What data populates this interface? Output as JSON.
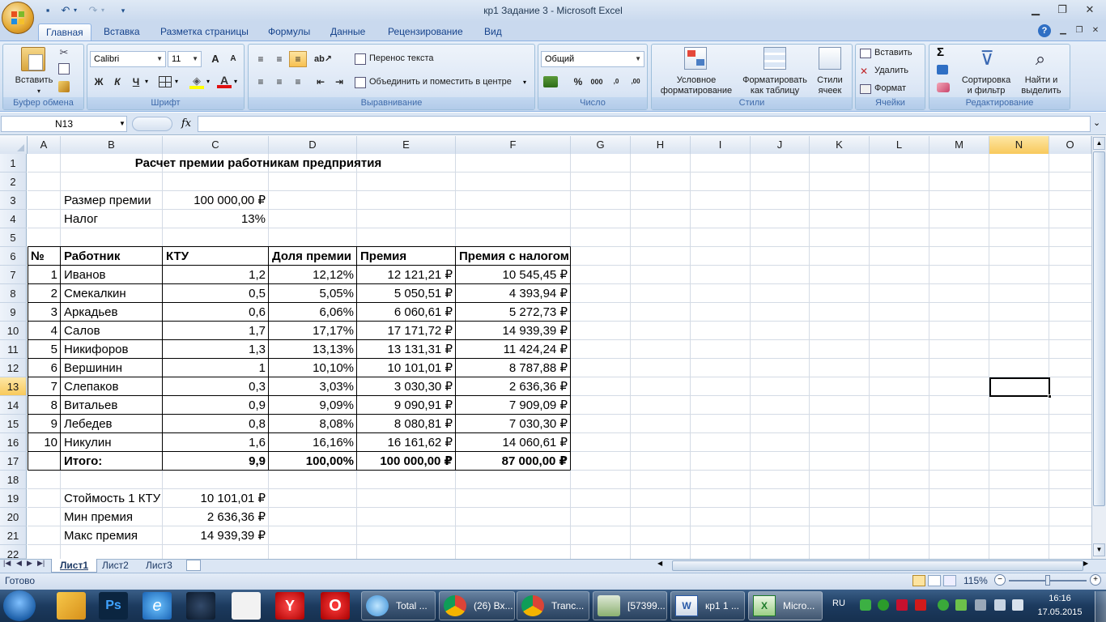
{
  "window": {
    "title": "кр1 Задание 3 - Microsoft Excel"
  },
  "ribbon": {
    "tabs": [
      "Главная",
      "Вставка",
      "Разметка страницы",
      "Формулы",
      "Данные",
      "Рецензирование",
      "Вид"
    ],
    "clipboard": {
      "label": "Буфер обмена",
      "paste": "Вставить"
    },
    "font": {
      "label": "Шрифт",
      "name": "Calibri",
      "size": "11",
      "grow": "A",
      "shrink": "A",
      "bold": "Ж",
      "italic": "К",
      "underline": "Ч"
    },
    "alignment": {
      "label": "Выравнивание",
      "wrap": "Перенос текста",
      "merge": "Объединить и поместить в центре"
    },
    "number": {
      "label": "Число",
      "format": "Общий",
      "percent": "%",
      "thousands": "000"
    },
    "styles": {
      "label": "Стили",
      "conditional": [
        "Условное",
        "форматирование"
      ],
      "as_table": [
        "Форматировать",
        "как таблицу"
      ],
      "cell_styles": [
        "Стили",
        "ячеек"
      ]
    },
    "cells": {
      "label": "Ячейки",
      "insert": "Вставить",
      "delete": "Удалить",
      "format": "Формат"
    },
    "editing": {
      "label": "Редактирование",
      "sort": [
        "Сортировка",
        "и фильтр"
      ],
      "find": [
        "Найти и",
        "выделить"
      ]
    }
  },
  "formula_bar": {
    "name_box": "N13",
    "fx": "fx",
    "value": ""
  },
  "columns": [
    "A",
    "B",
    "C",
    "D",
    "E",
    "F",
    "G",
    "H",
    "I",
    "J",
    "K",
    "L",
    "M",
    "N",
    "O"
  ],
  "rows": [
    "1",
    "2",
    "3",
    "4",
    "5",
    "6",
    "7",
    "8",
    "9",
    "10",
    "11",
    "12",
    "13",
    "14",
    "15",
    "16",
    "17",
    "18",
    "19",
    "20",
    "21",
    "22"
  ],
  "selected": {
    "column": "N",
    "row": "13"
  },
  "sheet": {
    "title": "Расчет премии работникам предприятия",
    "params": [
      {
        "label": "Размер премии",
        "value": "100 000,00 ₽"
      },
      {
        "label": "Налог",
        "value": "13%"
      }
    ],
    "headers": [
      "№",
      "Работник",
      "КТУ",
      "Доля премии",
      "Премия",
      "Премия с налогом"
    ],
    "employees": [
      {
        "n": "1",
        "name": "Иванов",
        "ktu": "1,2",
        "share": "12,12%",
        "bonus": "12 121,21 ₽",
        "taxed": "10 545,45 ₽"
      },
      {
        "n": "2",
        "name": "Смекалкин",
        "ktu": "0,5",
        "share": "5,05%",
        "bonus": "5 050,51 ₽",
        "taxed": "4 393,94 ₽"
      },
      {
        "n": "3",
        "name": "Аркадьев",
        "ktu": "0,6",
        "share": "6,06%",
        "bonus": "6 060,61 ₽",
        "taxed": "5 272,73 ₽"
      },
      {
        "n": "4",
        "name": "Салов",
        "ktu": "1,7",
        "share": "17,17%",
        "bonus": "17 171,72 ₽",
        "taxed": "14 939,39 ₽"
      },
      {
        "n": "5",
        "name": "Никифоров",
        "ktu": "1,3",
        "share": "13,13%",
        "bonus": "13 131,31 ₽",
        "taxed": "11 424,24 ₽"
      },
      {
        "n": "6",
        "name": "Вершинин",
        "ktu": "1",
        "share": "10,10%",
        "bonus": "10 101,01 ₽",
        "taxed": "8 787,88 ₽"
      },
      {
        "n": "7",
        "name": "Слепаков",
        "ktu": "0,3",
        "share": "3,03%",
        "bonus": "3 030,30 ₽",
        "taxed": "2 636,36 ₽"
      },
      {
        "n": "8",
        "name": "Витальев",
        "ktu": "0,9",
        "share": "9,09%",
        "bonus": "9 090,91 ₽",
        "taxed": "7 909,09 ₽"
      },
      {
        "n": "9",
        "name": "Лебедев",
        "ktu": "0,8",
        "share": "8,08%",
        "bonus": "8 080,81 ₽",
        "taxed": "7 030,30 ₽"
      },
      {
        "n": "10",
        "name": "Никулин",
        "ktu": "1,6",
        "share": "16,16%",
        "bonus": "16 161,62 ₽",
        "taxed": "14 060,61 ₽"
      }
    ],
    "total": {
      "label": "Итого:",
      "ktu": "9,9",
      "share": "100,00%",
      "bonus": "100 000,00 ₽",
      "taxed": "87 000,00 ₽"
    },
    "stats": [
      {
        "label": "Стоймость 1 КТУ",
        "value": "10 101,01 ₽"
      },
      {
        "label": "Мин премия",
        "value": "2 636,36 ₽"
      },
      {
        "label": "Макс премия",
        "value": "14 939,39 ₽"
      }
    ]
  },
  "sheet_tabs": [
    "Лист1",
    "Лист2",
    "Лист3"
  ],
  "status": {
    "ready": "Готово",
    "zoom": "115%"
  },
  "taskbar": {
    "buttons": [
      "Total ...",
      "(26) Вх...",
      "Tranc...",
      "[57399...",
      "кр1 1 ...",
      "Micro..."
    ],
    "lang": "RU",
    "time": "16:16",
    "date": "17.05.2015"
  }
}
